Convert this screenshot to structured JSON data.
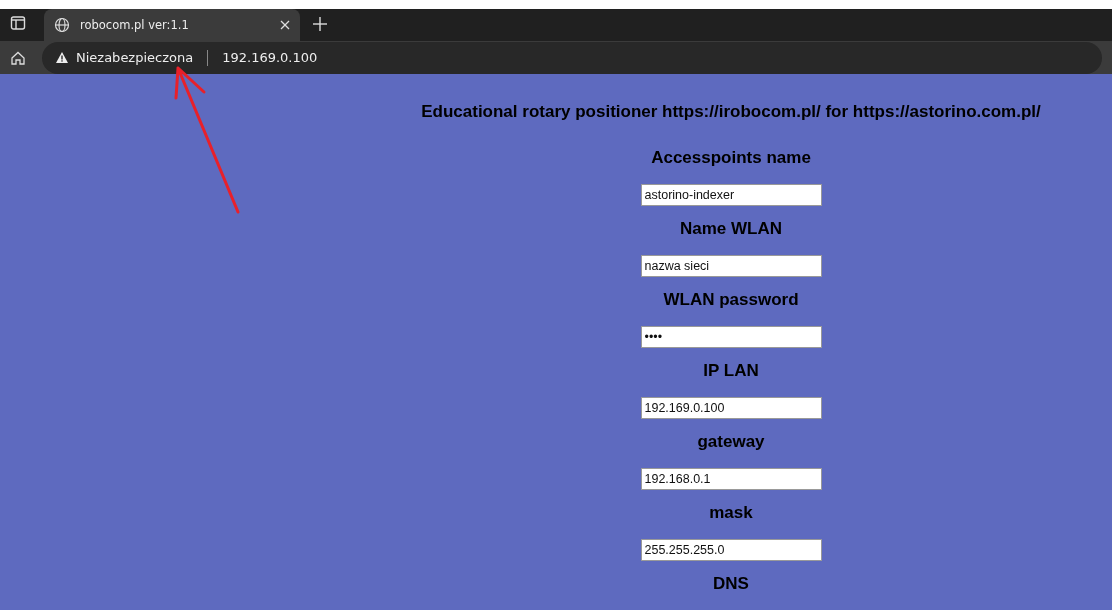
{
  "browser": {
    "tab": {
      "title": "robocom.pl ver:1.1",
      "selected": true
    },
    "address_bar": {
      "security_label": "Niezabezpieczona",
      "url": "192.169.0.100"
    }
  },
  "page": {
    "heading": "Educational rotary positioner https://irobocom.pl/ for https://astorino.com.pl/",
    "fields": [
      {
        "label": "Accesspoints name",
        "value": "astorino-indexer"
      },
      {
        "label": "Name WLAN",
        "value": "nazwa sieci"
      },
      {
        "label": "WLAN password",
        "value": "••••"
      },
      {
        "label": "IP LAN",
        "value": "192.169.0.100"
      },
      {
        "label": "gateway",
        "value": "192.168.0.1"
      },
      {
        "label": "mask",
        "value": "255.255.255.0"
      },
      {
        "label": "DNS"
      }
    ]
  }
}
